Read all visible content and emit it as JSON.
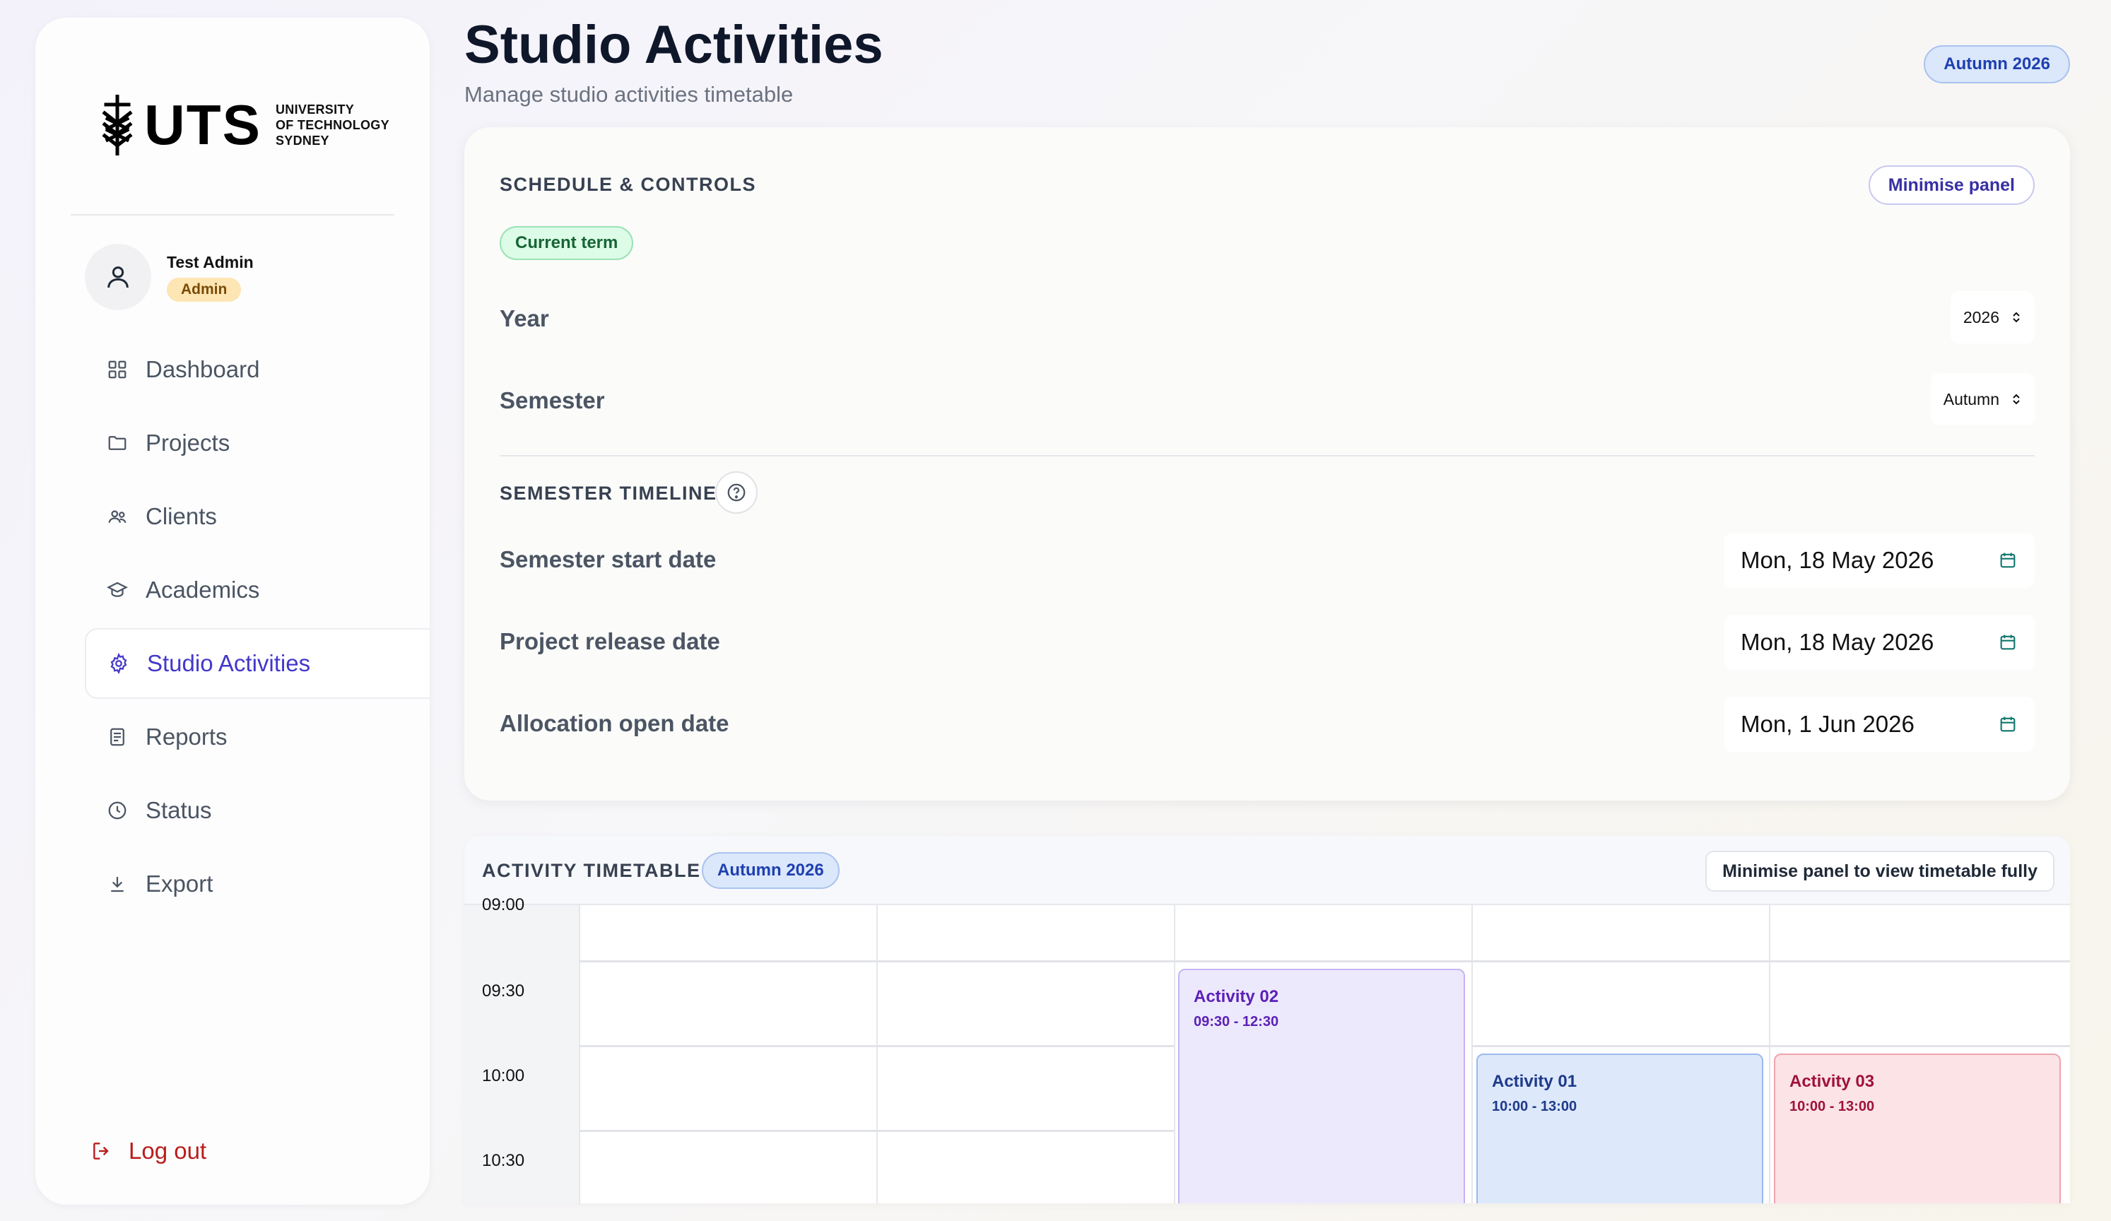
{
  "colors": {
    "accent": "#4338ca",
    "logout": "#b91c1c",
    "term_pill_bg": "#dbe7fb",
    "current_term_bg": "#dcfce7",
    "admin_badge_bg": "#fde6b3"
  },
  "sidebar": {
    "logo": {
      "wordmark": "UTS",
      "subtitle_lines": [
        "UNIVERSITY",
        "OF TECHNOLOGY",
        "SYDNEY"
      ]
    },
    "user": {
      "name": "Test Admin",
      "role": "Admin",
      "icon": "user-icon"
    },
    "nav": [
      {
        "label": "Dashboard",
        "icon": "grid-icon",
        "active": false
      },
      {
        "label": "Projects",
        "icon": "folder-icon",
        "active": false
      },
      {
        "label": "Clients",
        "icon": "users-icon",
        "active": false
      },
      {
        "label": "Academics",
        "icon": "graduation-cap-icon",
        "active": false
      },
      {
        "label": "Studio Activities",
        "icon": "gear-icon",
        "active": true
      },
      {
        "label": "Reports",
        "icon": "document-icon",
        "active": false
      },
      {
        "label": "Status",
        "icon": "clock-icon",
        "active": false
      },
      {
        "label": "Export",
        "icon": "download-icon",
        "active": false
      }
    ],
    "logout_label": "Log out"
  },
  "header": {
    "title": "Studio Activities",
    "subtitle": "Manage studio activities timetable",
    "term": "Autumn 2026"
  },
  "schedule": {
    "title": "SCHEDULE & CONTROLS",
    "minimise_label": "Minimise panel",
    "current_term_badge": "Current term",
    "year": {
      "label": "Year",
      "value": "2026"
    },
    "semester": {
      "label": "Semester",
      "value": "Autumn"
    },
    "timeline_title": "SEMESTER TIMELINE",
    "dates": [
      {
        "label": "Semester start date",
        "value": "Mon, 18 May 2026"
      },
      {
        "label": "Project release date",
        "value": "Mon, 18 May 2026"
      },
      {
        "label": "Allocation open date",
        "value": "Mon, 1 Jun 2026"
      }
    ]
  },
  "timetable": {
    "title": "ACTIVITY TIMETABLE",
    "term_badge": "Autumn 2026",
    "minimise_label": "Minimise panel to view timetable fully",
    "time_labels": [
      "09:00",
      "09:30",
      "10:00",
      "10:30"
    ],
    "events": [
      {
        "title": "Activity 02",
        "time": "09:30 - 12:30",
        "color": "purple"
      },
      {
        "title": "Activity 01",
        "time": "10:00 - 13:00",
        "color": "blue"
      },
      {
        "title": "Activity 03",
        "time": "10:00 - 13:00",
        "color": "red"
      }
    ]
  }
}
